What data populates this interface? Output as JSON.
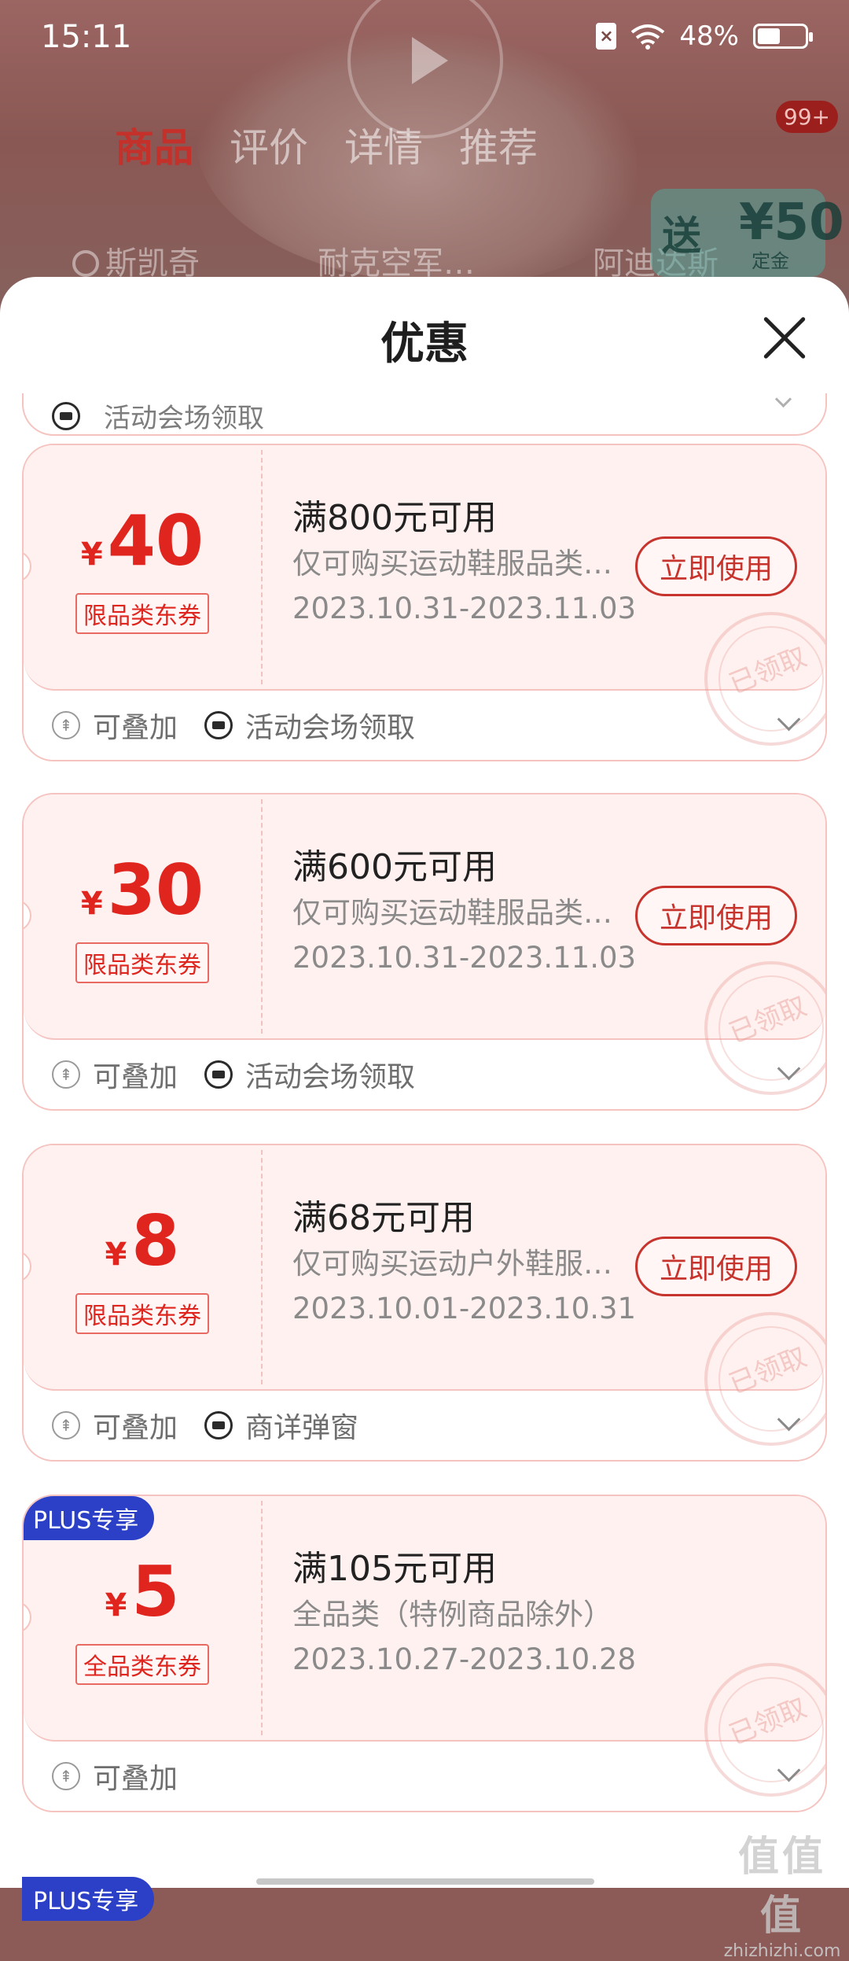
{
  "status_bar": {
    "time": "15:11",
    "battery": "48%",
    "battery_level": 0.48
  },
  "background": {
    "tabs": [
      "商品",
      "评价",
      "详情",
      "推荐"
    ],
    "active_tab": "商品",
    "cart_badge": "99+",
    "search_chips": [
      "斯凯奇",
      "耐克空军…",
      "阿迪达斯"
    ],
    "promo": {
      "label": "送",
      "amount": "¥50",
      "note": "定金"
    }
  },
  "sheet": {
    "title": "优惠",
    "partial_row": {
      "text": "活动会场领取"
    },
    "coupons": [
      {
        "currency": "¥",
        "amount": "40",
        "type": "限品类东券",
        "condition": "满800元可用",
        "scope": "仅可购买运动鞋服品类商品",
        "dates": "2023.10.31-2023.11.03",
        "button": "立即使用",
        "stamp": "已领取",
        "stackable": "可叠加",
        "source": "活动会场领取"
      },
      {
        "currency": "¥",
        "amount": "30",
        "type": "限品类东券",
        "condition": "满600元可用",
        "scope": "仅可购买运动鞋服品类商品",
        "dates": "2023.10.31-2023.11.03",
        "button": "立即使用",
        "stamp": "已领取",
        "stackable": "可叠加",
        "source": "活动会场领取"
      },
      {
        "currency": "¥",
        "amount": "8",
        "type": "限品类东券",
        "condition": "满68元可用",
        "scope": "仅可购买运动户外鞋服商品",
        "dates": "2023.10.01-2023.10.31",
        "button": "立即使用",
        "stamp": "已领取",
        "stackable": "可叠加",
        "source": "商详弹窗"
      },
      {
        "badge": "PLUS专享",
        "currency": "¥",
        "amount": "5",
        "type": "全品类东券",
        "condition": "满105元可用",
        "scope": "全品类（特例商品除外）",
        "dates": "2023.10.27-2023.10.28",
        "stamp": "已领取",
        "stackable": "可叠加"
      }
    ],
    "next_badge": "PLUS专享"
  },
  "watermark": {
    "big": "值值值",
    "small": "zhizhizhi.com"
  }
}
